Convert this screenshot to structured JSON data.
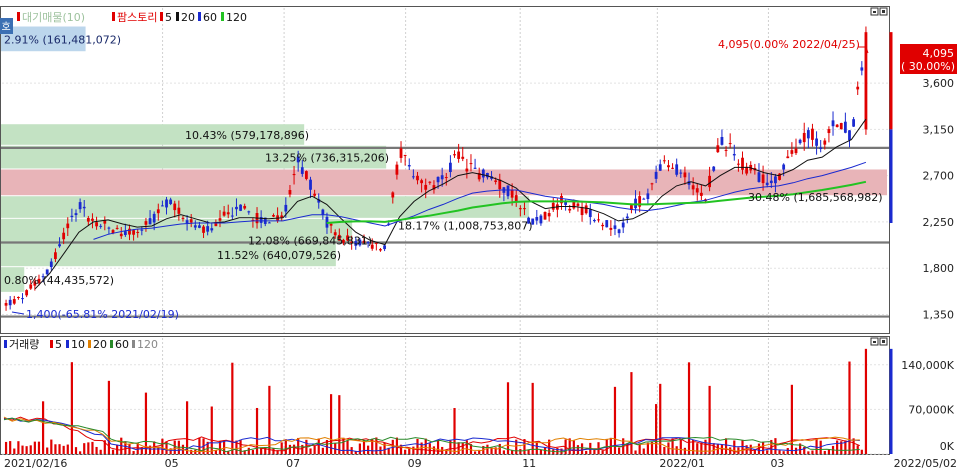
{
  "header": {
    "toggle_icon": "호",
    "legend_items": [
      {
        "label": "대기매물(10)",
        "color": "#9fc39f"
      },
      {
        "label": "팜스토리",
        "color": "#e00000"
      },
      {
        "label": "5",
        "color": "#e00000"
      },
      {
        "label": "20",
        "color": "#111111"
      },
      {
        "label": "60",
        "color": "#1a2ad0"
      },
      {
        "label": "120",
        "color": "#22c322"
      }
    ]
  },
  "volume_header": {
    "legend_items": [
      {
        "label": "거래량",
        "color": "#1a2ad0"
      },
      {
        "label": "5",
        "color": "#e00000"
      },
      {
        "label": "10",
        "color": "#1a2ad0"
      },
      {
        "label": "20",
        "color": "#e08000"
      },
      {
        "label": "60",
        "color": "#2a8a2a"
      },
      {
        "label": "120",
        "color": "#888888"
      }
    ]
  },
  "price_panel": {
    "last_price": "4,095",
    "last_change": "( 30.00%)",
    "high_annotation": "4,095(0.00% 2022/04/25)",
    "low_annotation": "1,400(-65.81% 2021/02/19)",
    "up_color": "#e00000",
    "down_color": "#1a2ad0"
  },
  "supply_bands": [
    {
      "label": "2.91% (161,481,072)"
    },
    {
      "label": "10.43% (579,178,896)"
    },
    {
      "label": "13.25% (736,315,206)"
    },
    {
      "label": "30.48% (1,685,568,982)"
    },
    {
      "label": "18.17% (1,008,753,807)"
    },
    {
      "label": "12.08% (669,845,831)"
    },
    {
      "label": "11.52% (640,079,526)"
    },
    {
      "label": "0.80% (44,435,572)"
    }
  ],
  "chart_data": [
    {
      "type": "candlestick",
      "title": "팜스토리",
      "x_tick_labels": [
        "2021/02/16",
        "05",
        "07",
        "09",
        "11",
        "2022/01",
        "03",
        "2022/05/02"
      ],
      "y_tick_labels": [
        "3,600",
        "3,150",
        "2,700",
        "2,250",
        "1,800",
        "1,350"
      ],
      "y_ticks": [
        3600,
        3150,
        2700,
        2250,
        1800,
        1350
      ],
      "ylim": [
        1170,
        4330
      ],
      "high": 4095,
      "low": 1400,
      "last": 4095,
      "last_change_pct": 30.0,
      "horizontal_lines": [
        2970,
        2050,
        1330
      ],
      "volume_profile": [
        {
          "low": 3900,
          "high": 4150,
          "pct": 2.91,
          "volume": 161481072
        },
        {
          "low": 2990,
          "high": 3200,
          "pct": 10.43,
          "volume": 579178896
        },
        {
          "low": 2760,
          "high": 2990,
          "pct": 13.25,
          "volume": 736315206
        },
        {
          "low": 2500,
          "high": 2760,
          "pct": 30.48,
          "volume": 1685568982
        },
        {
          "low": 2280,
          "high": 2500,
          "pct": 18.17,
          "volume": 1008753807
        },
        {
          "low": 2050,
          "high": 2280,
          "pct": 12.08,
          "volume": 669845831
        },
        {
          "low": 1810,
          "high": 2050,
          "pct": 11.52,
          "volume": 640079526
        },
        {
          "low": 1560,
          "high": 1810,
          "pct": 0.8,
          "volume": 44435572
        }
      ],
      "close_path": [
        1450,
        1500,
        1650,
        1800,
        2150,
        2420,
        2250,
        2200,
        2150,
        2150,
        2250,
        2450,
        2350,
        2200,
        2150,
        2300,
        2400,
        2300,
        2250,
        2300,
        2850,
        2600,
        2250,
        2100,
        2050,
        2020,
        2000,
        2950,
        2650,
        2600,
        2650,
        2900,
        2750,
        2700,
        2600,
        2500,
        2250,
        2300,
        2450,
        2400,
        2350,
        2250,
        2150,
        2400,
        2500,
        2800,
        2750,
        2650,
        2500,
        3050,
        2900,
        2750,
        2650,
        2700,
        2900,
        3150,
        2950,
        3250,
        3100,
        4095
      ],
      "moving_averages": [
        {
          "name": "20",
          "color": "#111111",
          "values": [
            null,
            null,
            1600,
            1750,
            1950,
            2150,
            2250,
            2270,
            2230,
            2200,
            2210,
            2280,
            2320,
            2280,
            2240,
            2250,
            2290,
            2290,
            2280,
            2290,
            2450,
            2500,
            2420,
            2280,
            2150,
            2070,
            2030,
            2300,
            2450,
            2550,
            2620,
            2700,
            2730,
            2700,
            2650,
            2580,
            2450,
            2380,
            2400,
            2400,
            2380,
            2330,
            2260,
            2280,
            2350,
            2500,
            2600,
            2640,
            2600,
            2700,
            2780,
            2780,
            2730,
            2700,
            2760,
            2850,
            2880,
            2980,
            3050,
            3250
          ]
        },
        {
          "name": "60",
          "color": "#1a2ad0",
          "values": [
            null,
            null,
            null,
            null,
            null,
            null,
            2080,
            2130,
            2160,
            2180,
            2190,
            2210,
            2230,
            2240,
            2240,
            2240,
            2250,
            2260,
            2260,
            2260,
            2290,
            2320,
            2320,
            2300,
            2270,
            2240,
            2210,
            2260,
            2310,
            2370,
            2420,
            2480,
            2530,
            2550,
            2560,
            2560,
            2530,
            2500,
            2480,
            2460,
            2440,
            2420,
            2390,
            2370,
            2360,
            2380,
            2410,
            2440,
            2460,
            2500,
            2540,
            2570,
            2590,
            2600,
            2630,
            2670,
            2700,
            2740,
            2780,
            2830
          ]
        },
        {
          "name": "120",
          "color": "#22c322",
          "values": [
            null,
            null,
            null,
            null,
            null,
            null,
            null,
            null,
            null,
            null,
            null,
            null,
            null,
            null,
            null,
            null,
            null,
            null,
            null,
            null,
            null,
            null,
            2240,
            2250,
            2255,
            2255,
            2250,
            2270,
            2290,
            2310,
            2335,
            2360,
            2390,
            2410,
            2430,
            2445,
            2450,
            2450,
            2450,
            2450,
            2445,
            2440,
            2430,
            2420,
            2420,
            2425,
            2430,
            2435,
            2440,
            2455,
            2470,
            2485,
            2495,
            2505,
            2520,
            2540,
            2560,
            2585,
            2610,
            2640
          ]
        }
      ]
    },
    {
      "type": "bar",
      "title": "거래량",
      "y_tick_labels": [
        "140,000K",
        "70,000K",
        "0K"
      ],
      "y_ticks": [
        140000,
        70000,
        0
      ],
      "ylim": [
        0,
        182000
      ],
      "unit": "K"
    }
  ]
}
